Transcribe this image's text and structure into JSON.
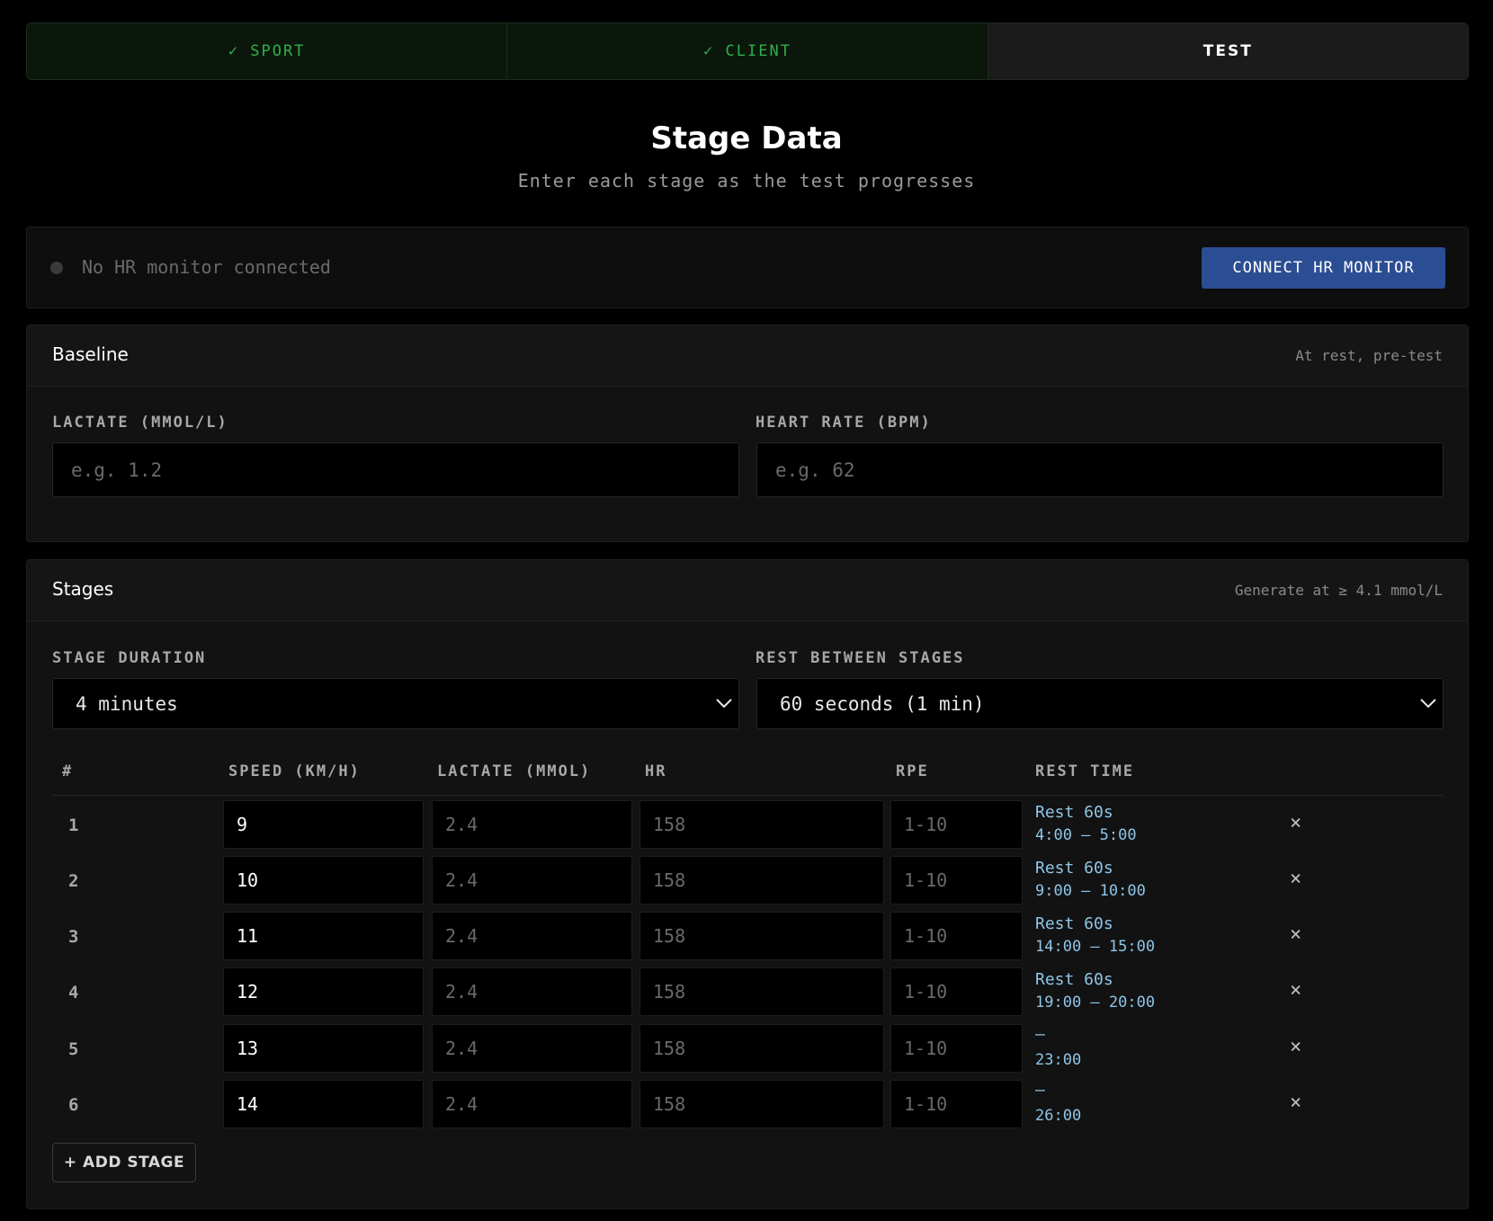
{
  "steps": [
    {
      "label": "✓ SPORT",
      "state": "done"
    },
    {
      "label": "✓ CLIENT",
      "state": "done"
    },
    {
      "label": "TEST",
      "state": "active"
    }
  ],
  "heading": {
    "title": "Stage Data",
    "subtitle": "Enter each stage as the test progresses"
  },
  "hr_monitor": {
    "status": "No HR monitor connected",
    "button": "CONNECT HR MONITOR"
  },
  "baseline": {
    "title": "Baseline",
    "note": "At rest, pre-test",
    "lactate_label": "LACTATE (MMOL/L)",
    "lactate_placeholder": "e.g. 1.2",
    "hr_label": "HEART RATE (BPM)",
    "hr_placeholder": "e.g. 62"
  },
  "stages": {
    "title": "Stages",
    "note": "Generate at ≥ 4.1 mmol/L",
    "duration_label": "STAGE DURATION",
    "duration_value": "4 minutes",
    "rest_label": "REST BETWEEN STAGES",
    "rest_value": "60 seconds (1 min)",
    "columns": [
      "#",
      "SPEED (KM/H)",
      "LACTATE (MMOL)",
      "HR",
      "RPE",
      "REST TIME"
    ],
    "rows": [
      {
        "num": "1",
        "speed": "9",
        "lactate": "2.4",
        "hr": "158",
        "rpe": "1-10",
        "rest": "Rest 60s",
        "time": "4:00 – 5:00"
      },
      {
        "num": "2",
        "speed": "10",
        "lactate": "2.4",
        "hr": "158",
        "rpe": "1-10",
        "rest": "Rest 60s",
        "time": "9:00 – 10:00"
      },
      {
        "num": "3",
        "speed": "11",
        "lactate": "2.4",
        "hr": "158",
        "rpe": "1-10",
        "rest": "Rest 60s",
        "time": "14:00 – 15:00"
      },
      {
        "num": "4",
        "speed": "12",
        "lactate": "2.4",
        "hr": "158",
        "rpe": "1-10",
        "rest": "Rest 60s",
        "time": "19:00 – 20:00"
      },
      {
        "num": "5",
        "speed": "13",
        "lactate": "2.4",
        "hr": "158",
        "rpe": "1-10",
        "rest": "—",
        "time": "23:00"
      },
      {
        "num": "6",
        "speed": "14",
        "lactate": "2.4",
        "hr": "158",
        "rpe": "1-10",
        "rest": "—",
        "time": "26:00"
      }
    ],
    "delete_glyph": "×",
    "add_button": "+ ADD STAGE"
  },
  "icons": {
    "hr_status": "status-dot-icon",
    "select": "chevron-down-icon",
    "delete": "close-icon"
  },
  "colors": {
    "accent_green": "#2fb04a",
    "button_blue": "#2b4d93",
    "rest_blue": "#8fc5e8"
  }
}
